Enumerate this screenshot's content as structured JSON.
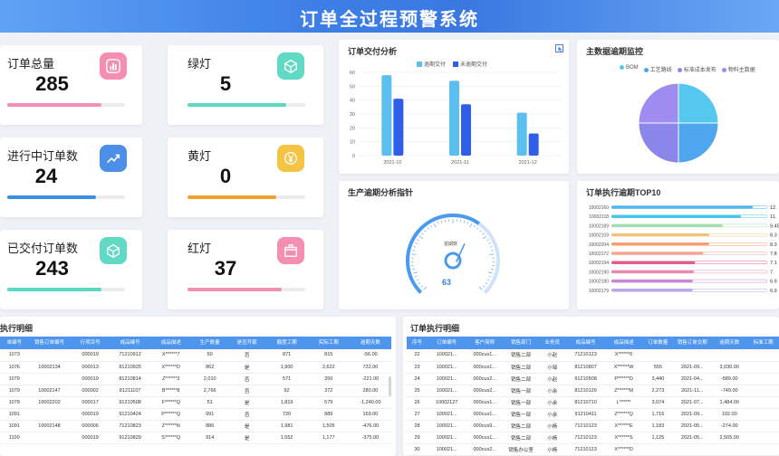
{
  "header": {
    "title": "订单全过程预警系统"
  },
  "stats": [
    {
      "label": "订单总量",
      "value": "285",
      "fill": 0.8,
      "bar_color": "#f28fb5",
      "icon_bg": "#f58fb2",
      "icon": "bar-chart-icon"
    },
    {
      "label": "绿灯",
      "value": "5",
      "fill": 0.84,
      "bar_color": "#5ad8c0",
      "icon_bg": "#62d9c4",
      "icon": "cube-icon"
    },
    {
      "label": "进行中订单数",
      "value": "24",
      "fill": 0.75,
      "bar_color": "#3c8fe0",
      "icon_bg": "#4b8fe8",
      "icon": "trend-icon"
    },
    {
      "label": "黄灯",
      "value": "0",
      "fill": 0.75,
      "bar_color": "#f0a22a",
      "icon_bg": "#f5c445",
      "icon": "yen-icon"
    },
    {
      "label": "已交付订单数",
      "value": "243",
      "fill": 0.8,
      "bar_color": "#5ad8c0",
      "icon_bg": "#62d9c4",
      "icon": "cube-icon"
    },
    {
      "label": "红灯",
      "value": "37",
      "fill": 0.8,
      "bar_color": "#f28fb5",
      "icon_bg": "#f58fb2",
      "icon": "box-icon"
    }
  ],
  "delivery": {
    "title": "订单交付分析",
    "chart_data": {
      "type": "bar",
      "categories": [
        "2021-10",
        "2021-11",
        "2021-12"
      ],
      "series": [
        {
          "name": "逾期交付",
          "values": [
            58,
            54,
            31
          ],
          "color": "#5bc0f0"
        },
        {
          "name": "未逾期交付",
          "values": [
            41,
            37,
            16
          ],
          "color": "#2f5fe8"
        }
      ],
      "ylim": [
        0,
        60
      ],
      "yticks": [
        0,
        10,
        20,
        30,
        40,
        50,
        60
      ]
    }
  },
  "monitor": {
    "title": "主数据逾期监控",
    "chart_data": {
      "type": "pie",
      "labels": [
        "BOM",
        "工艺路线",
        "标准成本发布",
        "物料主数据"
      ],
      "values": [
        25,
        25,
        25,
        25
      ],
      "colors": [
        "#56c8f0",
        "#4da6ee",
        "#8a86ea",
        "#9f8cf0"
      ]
    }
  },
  "gauge": {
    "title": "生产逾期分析指针",
    "label": "逾期数",
    "value": "63",
    "fraction": 0.63
  },
  "top10": {
    "title": "订单执行逾期TOP10",
    "chart_data": {
      "type": "bar",
      "categories": [
        "10002160",
        "10002118",
        "10002189",
        "10002109",
        "10002204",
        "10002172",
        "10002194",
        "10002190",
        "10002180",
        "10002179"
      ],
      "values": [
        12,
        11,
        9.45,
        8.3,
        8.3,
        7.8,
        7.1,
        7.0,
        6.9,
        6.9
      ],
      "value_labels": [
        "12.",
        "11.",
        "9.45",
        "8.3",
        "8.3",
        "7.8",
        "7.1",
        "7.",
        "6.9",
        "6.9"
      ],
      "colors": [
        "#4fb6ee",
        "#49c5ea",
        "#a3ddb3",
        "#f1c27a",
        "#f59e72",
        "#f4a593",
        "#e65d8d",
        "#e88ab1",
        "#c785d8",
        "#b9a8ec"
      ],
      "xlim": [
        0,
        12
      ]
    }
  },
  "left_table": {
    "title": "执行明细",
    "headers": [
      "单编号",
      "销售订单编号",
      "行项目号",
      "成品编号",
      "成品描述",
      "生产数量",
      "是否齐套",
      "额度工期",
      "实际工期",
      "逾期天数"
    ],
    "rows": [
      [
        "1073",
        "",
        "000019",
        "71210912",
        "X******7",
        "50",
        "否",
        "871",
        "815",
        "-56.00"
      ],
      [
        "1076",
        "10002134",
        "000013",
        "81210925",
        "X******D",
        "862",
        "是",
        "1,900",
        "2,622",
        "722.00"
      ],
      [
        "1079",
        "",
        "000019",
        "81210814",
        "Z******3",
        "2,010",
        "否",
        "571",
        "350",
        "-221.00"
      ],
      [
        "1079",
        "10002147",
        "000002",
        "81211107",
        "B******8",
        "2,766",
        "否",
        "92",
        "372",
        "280.00"
      ],
      [
        "1079",
        "10002202",
        "000017",
        "91210508",
        "F******Q",
        "51",
        "是",
        "1,819",
        "579",
        "-1,240.00"
      ],
      [
        "1091",
        "",
        "000019",
        "91210424",
        "P******Q",
        "991",
        "否",
        "720",
        "889",
        "169.00"
      ],
      [
        "1091",
        "10002148",
        "000006",
        "71210823",
        "Z******N",
        "886",
        "是",
        "1,981",
        "1,505",
        "-476.00"
      ],
      [
        "1100",
        "",
        "000019",
        "91210829",
        "S******Q",
        "914",
        "是",
        "1,552",
        "1,177",
        "-375.00"
      ]
    ]
  },
  "right_table": {
    "title": "订单执行明细",
    "headers": [
      "序号",
      "订单编号",
      "客户简称",
      "销售部门",
      "业务员",
      "成品编号",
      "成品描述",
      "订单数量",
      "销售订单交期",
      "逾期天数",
      "标准工期"
    ],
    "rows": [
      [
        "22",
        "100021...",
        "000cus1...",
        "销售二部",
        "小赵",
        "71210123",
        "X******6",
        "",
        "",
        "",
        ""
      ],
      [
        "23",
        "100021...",
        "000cus1...",
        "销售二部",
        "小邹",
        "81210807",
        "X******W",
        "555",
        "2021-09...",
        "3,030.00",
        ""
      ],
      [
        "24",
        "100021...",
        "000cus2...",
        "销售二部",
        "小赵",
        "91210508",
        "P******D",
        "3,440",
        "2021-04...",
        "-589.00",
        ""
      ],
      [
        "25",
        "100021...",
        "000cus2...",
        "销售一部",
        "小余",
        "81210126",
        "Z******M",
        "2,273",
        "2021-11...",
        "-749.00",
        ""
      ],
      [
        "26",
        "10002127",
        "000cus1...",
        "销售一部",
        "小余",
        "81210710",
        "L******",
        "3,074",
        "2021-07...",
        "1,484.00",
        ""
      ],
      [
        "27",
        "100021...",
        "000cus1...",
        "销售一部",
        "小余",
        "91210411",
        "Z******Q",
        "1,716",
        "2021-09...",
        "102.00",
        ""
      ],
      [
        "28",
        "100021...",
        "000cus9...",
        "销售二部",
        "小杨",
        "71210123",
        "X******E",
        "1,183",
        "2021-05...",
        "-274.00",
        ""
      ],
      [
        "29",
        "100021...",
        "000cus1...",
        "销售二部",
        "小杨",
        "71210123",
        "X******S",
        "1,125",
        "2021-05...",
        "2,505.00",
        ""
      ],
      [
        "30",
        "100021...",
        "000cus2...",
        "销售办公室",
        "小杨",
        "71210123",
        "X******D",
        "",
        "",
        "",
        ""
      ]
    ]
  }
}
